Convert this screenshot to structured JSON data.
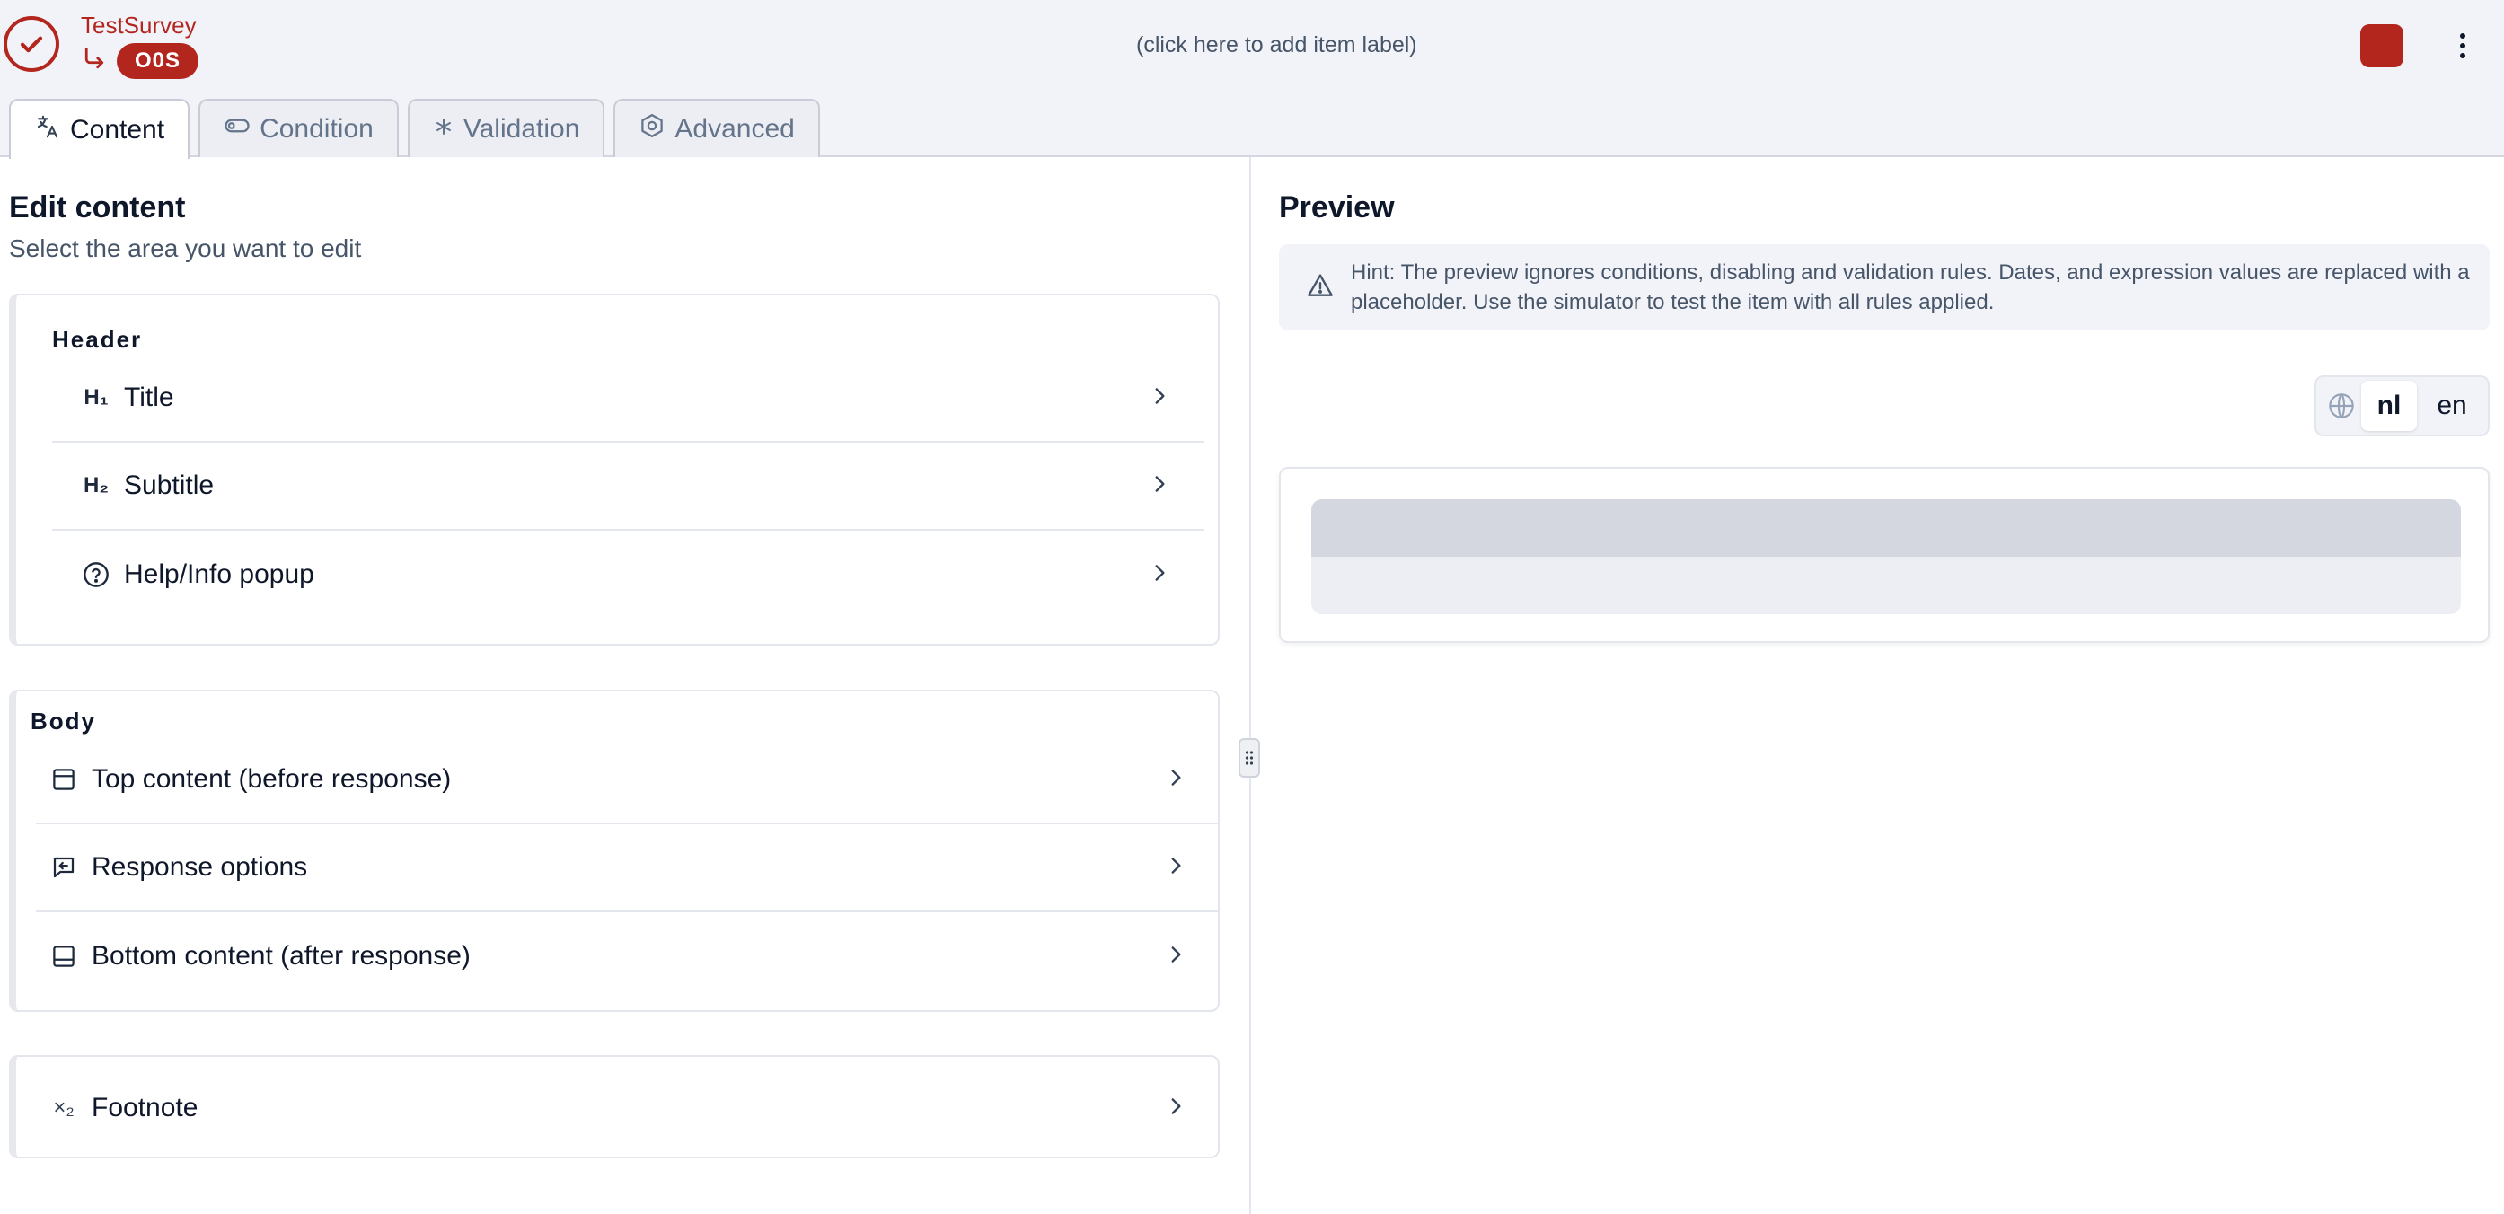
{
  "topbar": {
    "survey_name": "TestSurvey",
    "item_key": "O0S",
    "item_label_placeholder": "(click here to add item label)",
    "item_color": "#b3261e"
  },
  "tabs": [
    {
      "label": "Content",
      "icon": "translate-icon",
      "active": true
    },
    {
      "label": "Condition",
      "icon": "toggle-icon",
      "active": false
    },
    {
      "label": "Validation",
      "icon": "asterisk-icon",
      "active": false
    },
    {
      "label": "Advanced",
      "icon": "hexagon-settings-icon",
      "active": false
    }
  ],
  "edit": {
    "title": "Edit content",
    "subtitle": "Select the area you want to edit",
    "header": {
      "label": "Header",
      "items": [
        {
          "label": "Title",
          "icon": "heading-1-icon",
          "icon_text": "H₁"
        },
        {
          "label": "Subtitle",
          "icon": "heading-2-icon",
          "icon_text": "H₂"
        },
        {
          "label": "Help/Info popup",
          "icon": "help-circle-icon"
        }
      ]
    },
    "body": {
      "label": "Body",
      "items": [
        {
          "label": "Top content (before response)",
          "icon": "panel-top-icon"
        },
        {
          "label": "Response options",
          "icon": "message-reply-icon"
        },
        {
          "label": "Bottom content (after response)",
          "icon": "panel-bottom-icon"
        }
      ]
    },
    "footer": {
      "items": [
        {
          "label": "Footnote",
          "icon": "subscript-icon",
          "icon_text": "×₂"
        }
      ]
    }
  },
  "preview": {
    "title": "Preview",
    "hint": "Hint: The preview ignores conditions, disabling and validation rules. Dates, and expression values are replaced with a placeholder. Use the simulator to test the item with all rules applied.",
    "languages": [
      "nl",
      "en"
    ],
    "selected_language": "nl"
  },
  "colors": {
    "accent": "#b3261e",
    "topbar_bg": "#f1f3f8",
    "border": "#e3e6ec"
  }
}
